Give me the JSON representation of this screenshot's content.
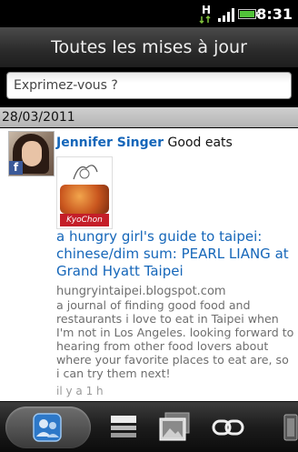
{
  "status_bar": {
    "time": "8:31",
    "icons": [
      "data-transfer-icon",
      "signal-icon",
      "battery-icon"
    ]
  },
  "header": {
    "title": "Toutes les mises à jour"
  },
  "compose": {
    "placeholder": "Exprimez-vous ?"
  },
  "feed": {
    "date": "28/03/2011",
    "items": [
      {
        "author": "Jennifer Singer",
        "text": "Good eats",
        "source_icon": "facebook-icon",
        "thumbnail_label": "KyoChon",
        "link_title": "a hungry girl's guide to taipei: chinese/dim sum: PEARL LIANG at Grand Hyatt Taipei",
        "link_domain": "hungryintaipei.blogspot.com",
        "link_description": "a journal of finding good food and restaurants i love to eat in Taipei when I'm not in Los Angeles. looking forward to hearing from other food lovers about where your favorite places to eat are, so i can try them next!",
        "timestamp": "il y a 1 h"
      }
    ]
  },
  "bottom_tabs": [
    {
      "name": "updates",
      "icon": "people-icon",
      "active": true
    },
    {
      "name": "status",
      "icon": "message-list-icon",
      "active": false
    },
    {
      "name": "photos",
      "icon": "photo-icon",
      "active": false
    },
    {
      "name": "links",
      "icon": "link-icon",
      "active": false
    },
    {
      "name": "more",
      "icon": "more-icon",
      "active": false
    }
  ],
  "colors": {
    "link_blue": "#1566b9",
    "facebook_blue": "#3b5998",
    "secondary_text": "#6e6e6e"
  }
}
